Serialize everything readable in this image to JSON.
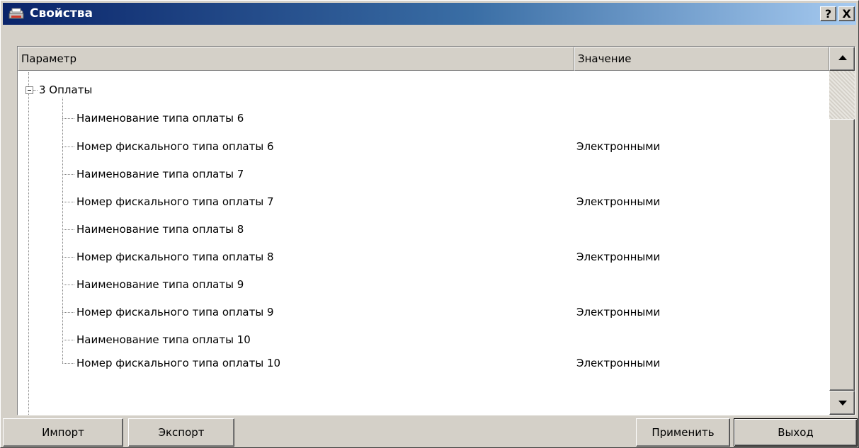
{
  "window": {
    "title": "Свойства",
    "help_label": "?",
    "close_label": "X"
  },
  "grid": {
    "columns": [
      "Параметр",
      "Значение"
    ],
    "group": "3 Оплаты",
    "rows": [
      {
        "param": "Наименование типа оплаты 6",
        "value": ""
      },
      {
        "param": "Номер фискального типа оплаты 6",
        "value": "Электронными"
      },
      {
        "param": "Наименование типа оплаты 7",
        "value": ""
      },
      {
        "param": "Номер фискального типа оплаты 7",
        "value": "Электронными"
      },
      {
        "param": "Наименование типа оплаты 8",
        "value": ""
      },
      {
        "param": "Номер фискального типа оплаты 8",
        "value": "Электронными"
      },
      {
        "param": "Наименование типа оплаты 9",
        "value": ""
      },
      {
        "param": "Номер фискального типа оплаты 9",
        "value": "Электронными"
      },
      {
        "param": "Наименование типа оплаты 10",
        "value": ""
      },
      {
        "param": "Номер фискального типа оплаты 10",
        "value": "Электронными"
      }
    ]
  },
  "buttons": {
    "import": "Импорт",
    "export": "Экспорт",
    "apply": "Применить",
    "exit": "Выход"
  },
  "colors": {
    "titlebar_start": "#0a246a",
    "titlebar_end": "#a6caf0",
    "face": "#d4d0c8"
  },
  "icons": {
    "title": "printer-icon",
    "expander": "tree-collapse-icon",
    "scroll_up": "arrow-up-icon",
    "scroll_down": "arrow-down-icon"
  }
}
